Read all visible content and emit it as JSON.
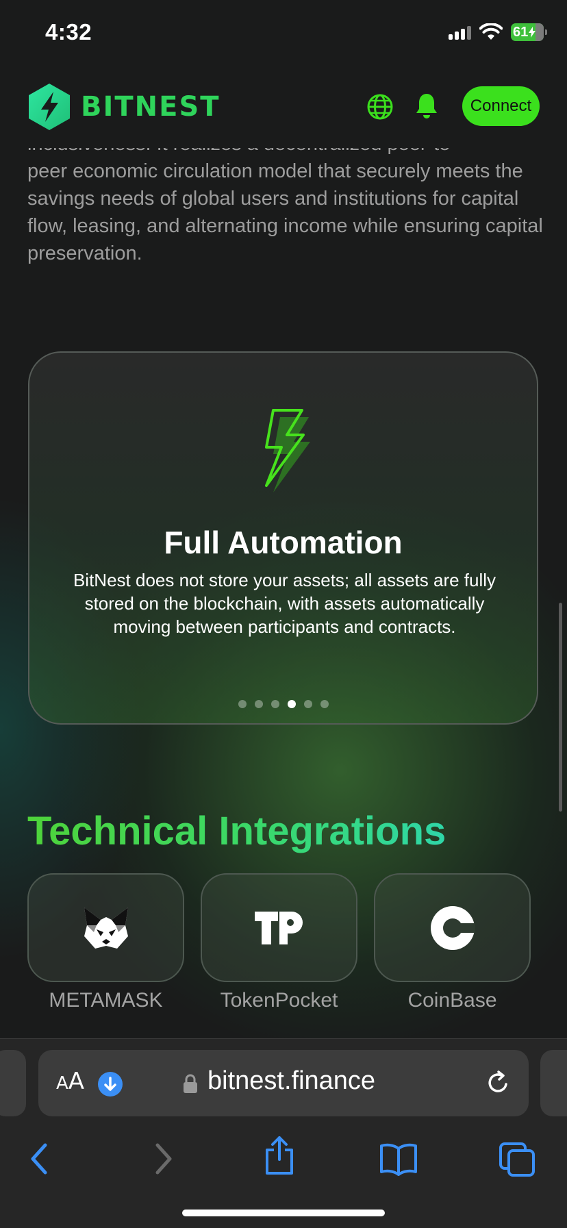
{
  "status_bar": {
    "time": "4:32",
    "battery": "61"
  },
  "header": {
    "logo_text": "BITNEST",
    "connect_label": "Connect"
  },
  "intro": {
    "partial_line": "inclusiveness. It realizes a decentralized peer-to-",
    "text": "peer economic circulation model that securely meets the savings needs of global users and institutions for capital flow, leasing, and alternating income while ensuring capital preservation."
  },
  "feature_card": {
    "title": "Full Automation",
    "description": "BitNest does not store your assets; all assets are fully stored on the blockchain, with assets automatically moving between participants and contracts.",
    "page_count": 6,
    "active_page": 4
  },
  "integrations": {
    "title": "Technical Integrations",
    "items": [
      {
        "label": "METAMASK",
        "icon": "metamask-fox-icon"
      },
      {
        "label": "TokenPocket",
        "icon": "tokenpocket-tp-icon"
      },
      {
        "label": "CoinBase",
        "icon": "coinbase-c-icon"
      }
    ]
  },
  "browser": {
    "aa_label": "AA",
    "url": "bitnest.finance"
  },
  "colors": {
    "accent": "#3be01d",
    "logo": "#2fd45b",
    "browser_blue": "#3b8ff5"
  }
}
